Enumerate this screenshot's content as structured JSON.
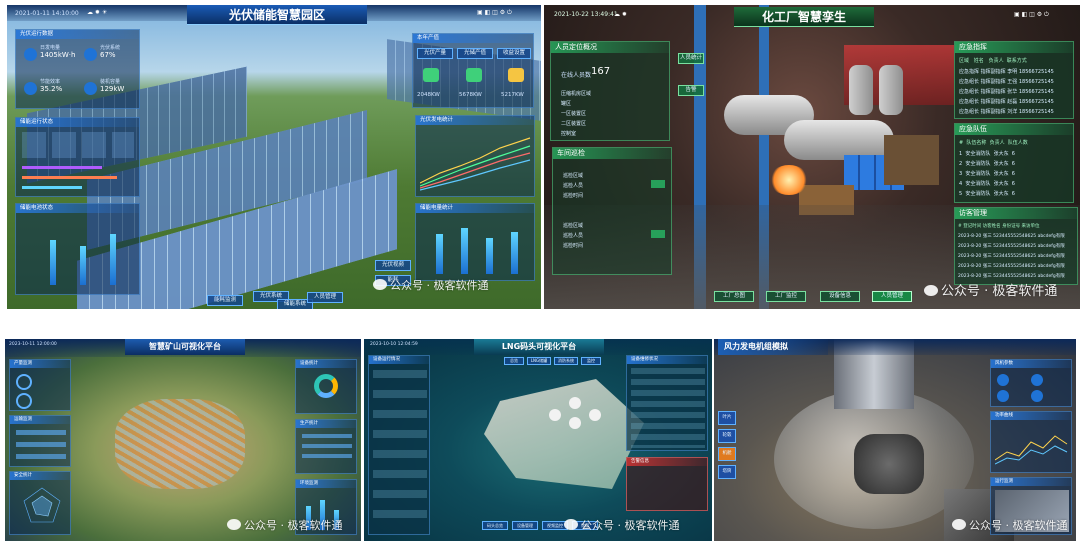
{
  "solar": {
    "title": "光伏储能智慧园区",
    "datetime": "2021-01-11  14:10:00",
    "left_panel1_title": "光伏运行数据",
    "metrics": [
      {
        "label": "日发电量",
        "value": "1405kW·h"
      },
      {
        "label": "光伏系统",
        "value": "67%"
      },
      {
        "label": "节能效率",
        "value": "35.2%"
      },
      {
        "label": "装机容量",
        "value": "129kW"
      }
    ],
    "left_panel2_title": "储能运行状态",
    "left_panel3_title": "储能电池状态",
    "right_panel1_title": "本年产值",
    "tabs": [
      "光伏产量",
      "光储产值",
      "收益设置"
    ],
    "stats": [
      "2048KW",
      "5678KW",
      "5217KW"
    ],
    "right_panel2_title": "光伏发电统计",
    "right_panel3_title": "储能电量统计",
    "bottom_buttons": [
      "能耗监测",
      "光伏系统",
      "储能系统",
      "人员管理"
    ],
    "mini_buttons": [
      "光伏视频",
      "能耗"
    ]
  },
  "chem": {
    "title": "化工厂智慧孪生",
    "datetime": "2021-10-22  13:49:41",
    "left_panel1_title": "人员定位概况",
    "count_label": "在线人员数",
    "count_value": "167",
    "areas": [
      "压缩机房区域",
      "罐区",
      "一区装置区",
      "二区装置区",
      "控制室"
    ],
    "inspect_title": "车间巡检",
    "inspect_rows": [
      "巡检区域",
      "巡检人员",
      "巡检时间",
      "巡检区域",
      "巡检人员",
      "巡检时间"
    ],
    "right_panel1_title": "应急指挥",
    "emergency_headers": [
      "区域",
      "姓名",
      "负责人",
      "联系方式"
    ],
    "emergency_rows": [
      [
        "1",
        "应急指挥",
        "指挥副指挥",
        "李明",
        "18566725145"
      ],
      [
        "2",
        "应急组长",
        "指挥副指挥",
        "王强",
        "18566725145"
      ],
      [
        "3",
        "应急组长",
        "指挥副指挥",
        "张华",
        "18566725145"
      ],
      [
        "4",
        "应急组长",
        "指挥副指挥",
        "赵磊",
        "18566725145"
      ],
      [
        "5",
        "应急组长",
        "指挥副指挥",
        "刘洋",
        "18566725145"
      ]
    ],
    "right_panel2_title": "应急队伍",
    "team_headers": [
      "#",
      "队伍名称",
      "负责人",
      "队伍人数"
    ],
    "team_rows": [
      [
        "1",
        "安全消防队",
        "张大东",
        "6"
      ],
      [
        "2",
        "安全消防队",
        "张大东",
        "6"
      ],
      [
        "3",
        "安全消防队",
        "张大东",
        "6"
      ],
      [
        "4",
        "安全消防队",
        "张大东",
        "6"
      ],
      [
        "5",
        "安全消防队",
        "张大东",
        "6"
      ]
    ],
    "right_panel3_title": "访客管理",
    "visitor_headers": [
      "#",
      "登记时间",
      "访客姓名",
      "身份证号",
      "来访单位"
    ],
    "visitor_rows": [
      [
        "2023-8-20",
        "张三",
        "523445552548625",
        "abcdefg有限"
      ],
      [
        "2023-8-20",
        "张三",
        "523445552548625",
        "abcdefg有限"
      ],
      [
        "2023-8-20",
        "张三",
        "523445552548625",
        "abcdefg有限"
      ],
      [
        "2023-8-20",
        "张三",
        "523445552548625",
        "abcdefg有限"
      ],
      [
        "2023-8-20",
        "张三",
        "523445552548625",
        "abcdefg有限"
      ]
    ],
    "bottom_buttons": [
      "工厂总图",
      "工厂监控",
      "设备信息",
      "人员管理"
    ],
    "left_tags": [
      "人员统计",
      "告警"
    ]
  },
  "mine": {
    "title": "智慧矿山可视化平台",
    "datetime": "2023-10-11  12:00:00",
    "left_titles": [
      "产量监测",
      "运输监测",
      "安全统计"
    ],
    "right_titles": [
      "设备统计",
      "生产统计",
      "环境监测"
    ]
  },
  "lng": {
    "title": "LNG码头可视化平台",
    "datetime": "2023-10-10  12:04:59",
    "tabs": [
      "总览",
      "LNG储罐",
      "消防系统",
      "监控"
    ],
    "left_title": "设备运行情况",
    "right_title": "设备维修状况",
    "bottom_buttons": [
      "码头总览",
      "设备管理",
      "视频监控",
      "储罐"
    ],
    "alert_title": "告警信息"
  },
  "wind": {
    "title": "风力发电机组模拟",
    "side_buttons": [
      "叶片",
      "轮毂",
      "机舱",
      "塔筒"
    ],
    "right_titles": [
      "风机参数",
      "功率曲线",
      "运行监测"
    ]
  },
  "watermark": "公众号 · 极客软件通"
}
